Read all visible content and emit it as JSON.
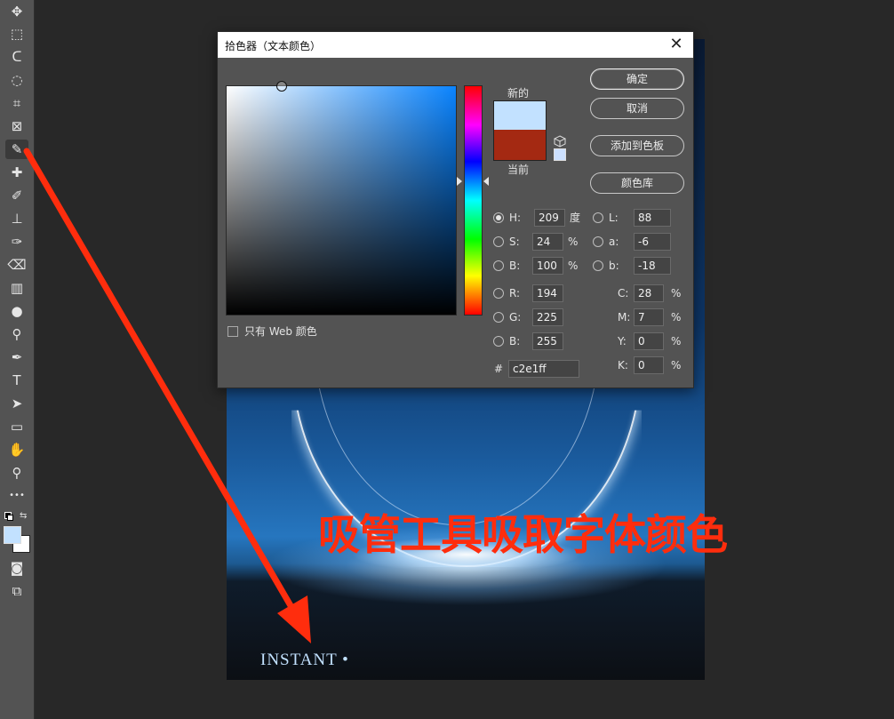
{
  "toolbar": {
    "tools": [
      {
        "name": "move-tool-icon",
        "glyph": "✥"
      },
      {
        "name": "marquee-tool-icon",
        "glyph": "⬚"
      },
      {
        "name": "lasso-tool-icon",
        "glyph": "ᑕ"
      },
      {
        "name": "quick-select-tool-icon",
        "glyph": "◌"
      },
      {
        "name": "crop-tool-icon",
        "glyph": "⌗"
      },
      {
        "name": "frame-tool-icon",
        "glyph": "⊠"
      },
      {
        "name": "eyedropper-tool-icon",
        "glyph": "✎"
      },
      {
        "name": "healing-brush-tool-icon",
        "glyph": "✚"
      },
      {
        "name": "brush-tool-icon",
        "glyph": "✐"
      },
      {
        "name": "stamp-tool-icon",
        "glyph": "⊥"
      },
      {
        "name": "history-brush-tool-icon",
        "glyph": "✑"
      },
      {
        "name": "eraser-tool-icon",
        "glyph": "⌫"
      },
      {
        "name": "gradient-tool-icon",
        "glyph": "▥"
      },
      {
        "name": "blur-tool-icon",
        "glyph": "●"
      },
      {
        "name": "dodge-tool-icon",
        "glyph": "⚲"
      },
      {
        "name": "pen-tool-icon",
        "glyph": "✒"
      },
      {
        "name": "type-tool-icon",
        "glyph": "T"
      },
      {
        "name": "path-select-tool-icon",
        "glyph": "➤"
      },
      {
        "name": "rectangle-tool-icon",
        "glyph": "▭"
      },
      {
        "name": "hand-tool-icon",
        "glyph": "✋"
      },
      {
        "name": "zoom-tool-icon",
        "glyph": "⚲"
      },
      {
        "name": "more-tools-icon",
        "glyph": "•••"
      }
    ],
    "foreground_color": "#c2e1ff",
    "background_color": "#ffffff",
    "bottom": [
      {
        "name": "quick-mask-icon",
        "glyph": "◙"
      },
      {
        "name": "screen-mode-icon",
        "glyph": "⧉"
      }
    ]
  },
  "canvas": {
    "text": "INSTANT •"
  },
  "annotation": {
    "text": "吸管工具吸取字体颜色",
    "color": "#ff2d0d"
  },
  "dialog": {
    "title": "拾色器（文本颜色）",
    "close": "✕",
    "new_label": "新的",
    "current_label": "当前",
    "new_color": "#c2e1ff",
    "current_color": "#a42912",
    "buttons": {
      "ok": "确定",
      "cancel": "取消",
      "add_to_swatches": "添加到色板",
      "color_libraries": "颜色库"
    },
    "web_only": "只有 Web 颜色",
    "hsb": {
      "h_label": "H:",
      "h_value": "209",
      "h_unit": "度",
      "s_label": "S:",
      "s_value": "24",
      "s_unit": "%",
      "b_label": "B:",
      "b_value": "100",
      "b_unit": "%"
    },
    "lab": {
      "l_label": "L:",
      "l_value": "88",
      "a_label": "a:",
      "a_value": "-6",
      "b_label": "b:",
      "b_value": "-18"
    },
    "rgb": {
      "r_label": "R:",
      "r_value": "194",
      "g_label": "G:",
      "g_value": "225",
      "b_label": "B:",
      "b_value": "255"
    },
    "cmyk": {
      "c_label": "C:",
      "c_value": "28",
      "m_label": "M:",
      "m_value": "7",
      "y_label": "Y:",
      "y_value": "0",
      "k_label": "K:",
      "k_value": "0",
      "unit": "%"
    },
    "hex_label": "#",
    "hex_value": "c2e1ff"
  }
}
